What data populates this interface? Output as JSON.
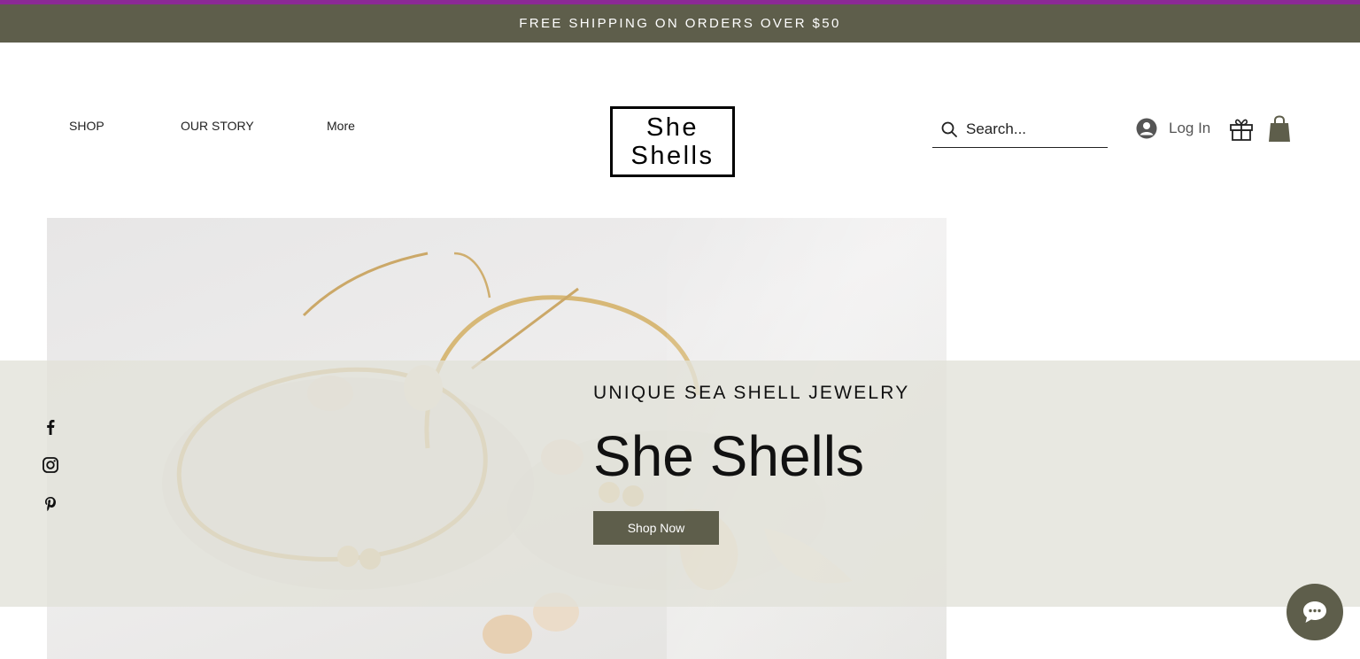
{
  "promo": {
    "text": "FREE SHIPPING ON ORDERS OVER $50"
  },
  "nav": {
    "items": [
      {
        "label": "SHOP"
      },
      {
        "label": "OUR STORY"
      },
      {
        "label": "More"
      }
    ]
  },
  "logo": {
    "line1": "She",
    "line2": "Shells"
  },
  "search": {
    "placeholder": "Search..."
  },
  "account": {
    "login_label": "Log In"
  },
  "hero": {
    "subtitle": "UNIQUE SEA SHELL JEWELRY",
    "title": "She Shells",
    "button_label": "Shop Now"
  },
  "social": {
    "icons": [
      "facebook-icon",
      "instagram-icon",
      "pinterest-icon"
    ]
  },
  "colors": {
    "accent": "#5e5e4b",
    "top_line": "#8b2a96",
    "band": "#e1e1d8",
    "background": "#ffffff"
  }
}
